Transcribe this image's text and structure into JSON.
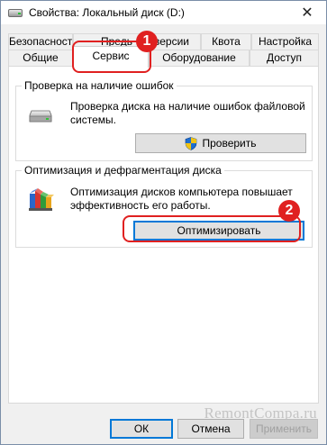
{
  "window": {
    "title": "Свойства: Локальный диск (D:)",
    "close_glyph": "✕"
  },
  "tabs": {
    "row1": [
      "Безопасность",
      "Предыдущие версии",
      "Квота",
      "Настройка"
    ],
    "row1_visible": [
      "Безопасность",
      "Предь",
      "версии",
      "Квота",
      "Настройка"
    ],
    "row2": [
      "Общие",
      "Сервис",
      "Оборудование",
      "Доступ"
    ],
    "active": "Сервис"
  },
  "check_group": {
    "legend": "Проверка на наличие ошибок",
    "text": "Проверка диска на наличие ошибок файловой системы.",
    "button": "Проверить",
    "icon": "drive-icon",
    "button_icon": "uac-shield-icon"
  },
  "optimize_group": {
    "legend": "Оптимизация и дефрагментация диска",
    "text": "Оптимизация дисков компьютера повышает эффективность его работы.",
    "button": "Оптимизировать",
    "icon": "defrag-icon"
  },
  "footer": {
    "ok": "ОК",
    "cancel": "Отмена",
    "apply": "Применить"
  },
  "annotations": {
    "badge1": "1",
    "badge2": "2",
    "color": "#e02020"
  },
  "watermark": "RemontCompa.ru"
}
